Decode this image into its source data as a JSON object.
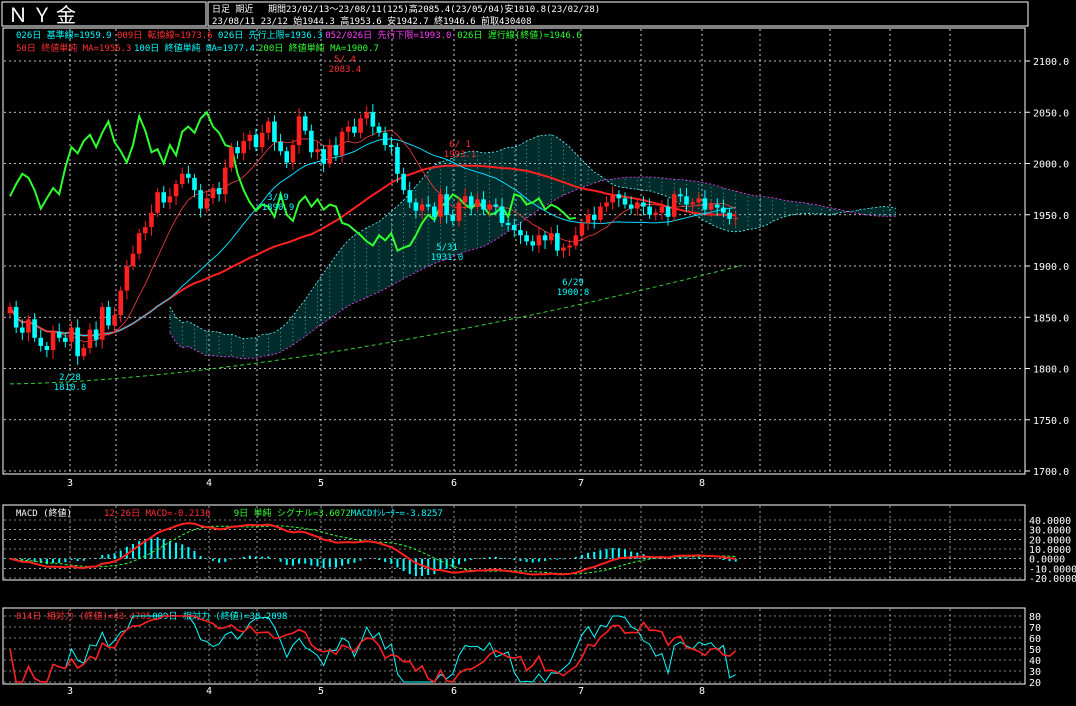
{
  "header": {
    "title": "ＮＹ金",
    "mode": "日足 期近",
    "period_line": "期間23/02/13～23/08/11(125)高2085.4(23/05/04)安1810.8(23/02/28)",
    "detail_line": "23/08/11 23/12 始1944.3 高1953.6 安1942.7 終1946.6 前取430408"
  },
  "legend": {
    "row1": [
      {
        "text": "026日 基準線=1959.9",
        "color": "#00ffff"
      },
      {
        "text": "009日 転換線=1973.6",
        "color": "#ff3030"
      },
      {
        "text": "026日 先行上限=1936.3",
        "color": "#00ffff"
      },
      {
        "text": "052/026日 先行下限=1993.0",
        "color": "#ff40ff"
      },
      {
        "text": "026日 遅行線(終値)=1946.6",
        "color": "#30ff30"
      }
    ],
    "row2": [
      {
        "text": "50日 終値単純 MA=1956.3",
        "color": "#ff3030"
      },
      {
        "text": "100日 終値単純 MA=1977.4",
        "color": "#00ffff"
      },
      {
        "text": "200日 終値単純 MA=1900.7",
        "color": "#30ff30"
      }
    ]
  },
  "macd_legend": {
    "title": "MACD (終値)",
    "items": [
      {
        "text": "12-26日 MACD=-0.2136",
        "color": "#ff3030"
      },
      {
        "text": "9日 単純 シグナル=3.6072",
        "color": "#30ff30"
      },
      {
        "text": "MACDｵｼﾚｰﾀｰ=-3.8257",
        "color": "#00ffff"
      }
    ]
  },
  "rsi_legend": {
    "items": [
      {
        "text": "014日 相対力 (終値)=43.4705",
        "color": "#ff3030"
      },
      {
        "text": "009日 相対力 (終値)=38.2098",
        "color": "#00ffff"
      }
    ]
  },
  "chart_data": [
    {
      "type": "candlestick",
      "title": "ＮＹ金 日足",
      "y_ticks": [
        "2100.0",
        "2050.0",
        "2000.0",
        "1950.0",
        "1900.0",
        "1850.0",
        "1800.0",
        "1750.0",
        "1700.0"
      ],
      "ylim": [
        1700,
        2100
      ],
      "x_tick_labels": [
        "3",
        "4",
        "5",
        "6",
        "7",
        "8"
      ],
      "annotations": [
        {
          "label": "5/ 4",
          "value": "2083.4",
          "color": "#ff3030"
        },
        {
          "label": "3/19",
          "value": "1890.9",
          "color": "#00ffff"
        },
        {
          "label": "5/31",
          "value": "1931.0",
          "color": "#00ffff"
        },
        {
          "label": "6/ 1",
          "value": "1993.1",
          "color": "#ff3030"
        },
        {
          "label": "6/29",
          "value": "1900.8",
          "color": "#00ffff"
        },
        {
          "label": "2/28",
          "value": "1810.8",
          "color": "#00ffff"
        }
      ],
      "closes": [
        1860,
        1840,
        1835,
        1848,
        1830,
        1822,
        1818,
        1836,
        1830,
        1826,
        1840,
        1812,
        1820,
        1838,
        1828,
        1860,
        1842,
        1852,
        1876,
        1900,
        1912,
        1932,
        1938,
        1952,
        1972,
        1962,
        1968,
        1980,
        1990,
        1986,
        1974,
        1956,
        1966,
        1976,
        1970,
        1996,
        2016,
        2010,
        2022,
        2028,
        2016,
        2030,
        2041,
        2021,
        2012,
        2001,
        2018,
        2046,
        2032,
        2011,
        2014,
        2000,
        2018,
        2008,
        2031,
        2036,
        2030,
        2044,
        2050,
        2036,
        2030,
        2018,
        2016,
        1990,
        1974,
        1962,
        1954,
        1960,
        1958,
        1948,
        1970,
        1950,
        1944,
        1962,
        1968,
        1958,
        1965,
        1955,
        1960,
        1958,
        1942,
        1940,
        1935,
        1930,
        1924,
        1920,
        1930,
        1925,
        1932,
        1915,
        1918,
        1920,
        1930,
        1942,
        1950,
        1945,
        1958,
        1962,
        1970,
        1966,
        1960,
        1956,
        1962,
        1958,
        1950,
        1952,
        1958,
        1948,
        1970,
        1968,
        1960,
        1962,
        1966,
        1955,
        1960,
        1957,
        1952,
        1946,
        1947
      ],
      "ma50_end": 1956.3,
      "ma200_end": 1900.7
    },
    {
      "type": "line",
      "title": "MACD (終値)",
      "y_ticks": [
        "40.0000",
        "30.0000",
        "20.0000",
        "10.0000",
        "0.0000",
        "-10.0000",
        "-20.0000"
      ],
      "ylim": [
        -20,
        40
      ],
      "series": [
        {
          "name": "12-26日 MACD",
          "color": "#ff3030",
          "last": -0.2136
        },
        {
          "name": "9日 単純 シグナル",
          "color": "#30ff30",
          "last": 3.6072
        },
        {
          "name": "MACDｵｼﾚｰﾀｰ",
          "color": "#00ffff",
          "last": -3.8257
        }
      ]
    },
    {
      "type": "line",
      "title": "相対力",
      "y_ticks": [
        "80",
        "70",
        "60",
        "50",
        "40",
        "30",
        "20"
      ],
      "ylim": [
        20,
        80
      ],
      "series": [
        {
          "name": "014日 相対力 (終値)",
          "color": "#ff3030",
          "last": 43.4705
        },
        {
          "name": "009日 相対力 (終値)",
          "color": "#00ffff",
          "last": 38.2098
        }
      ]
    }
  ]
}
